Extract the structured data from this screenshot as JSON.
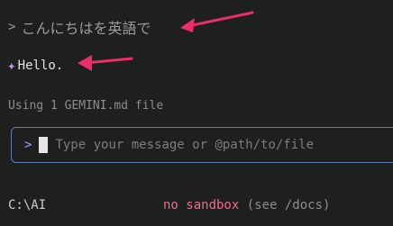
{
  "history": {
    "user_prompt_symbol": ">",
    "user_message": "こんにちはを英語で",
    "response_icon": "sparkle-icon",
    "response_text": "Hello."
  },
  "status": {
    "context_info": "Using 1 GEMINI.md file"
  },
  "input": {
    "prompt_symbol": ">",
    "placeholder": "Type your message or @path/to/file"
  },
  "footer": {
    "cwd": "C:\\AI",
    "sandbox_status": "no sandbox",
    "sandbox_hint": "(see /docs)"
  },
  "colors": {
    "background": "#1e1f1f",
    "accent_purple": "#c58af9",
    "input_border": "#5e7fb2",
    "warning_pink": "#f06c8c",
    "annotation_arrow": "#ef2d68"
  }
}
